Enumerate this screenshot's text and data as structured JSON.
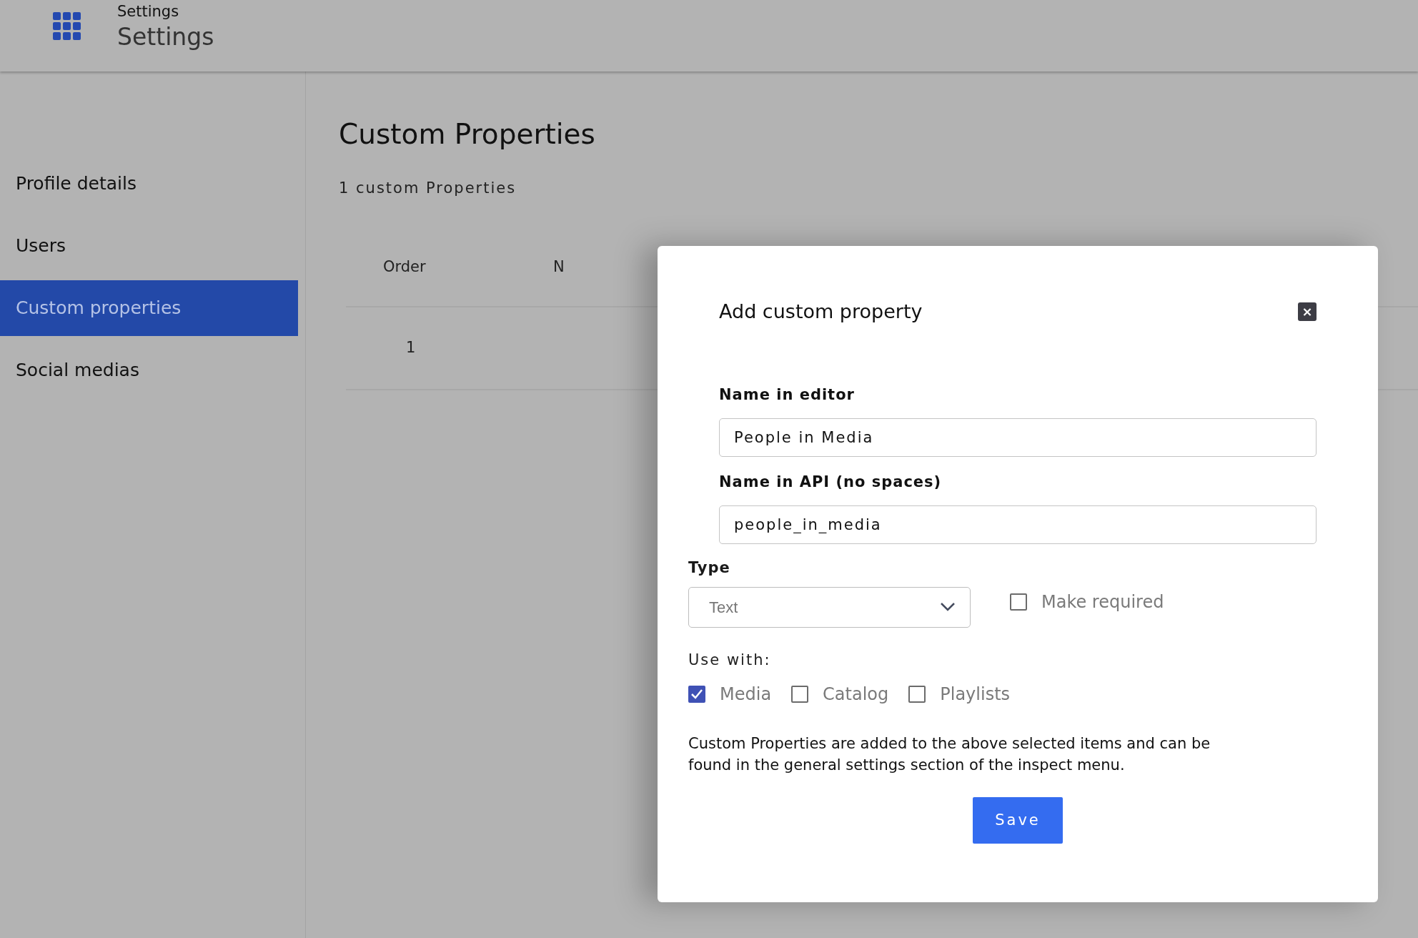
{
  "header": {
    "subtitle": "Settings",
    "title": "Settings"
  },
  "sidebar": {
    "items": [
      {
        "label": "Profile details",
        "selected": false
      },
      {
        "label": "Users",
        "selected": false
      },
      {
        "label": "Custom properties",
        "selected": true
      },
      {
        "label": "Social medias",
        "selected": false
      }
    ]
  },
  "main": {
    "heading": "Custom Properties",
    "count": "1 custom Properties",
    "table": {
      "columns": [
        "Order",
        "N"
      ],
      "rows": [
        [
          "1"
        ]
      ]
    }
  },
  "dialog": {
    "title": "Add custom property",
    "close": "×",
    "fields": [
      {
        "label": "Name in editor",
        "value": "People in Media"
      },
      {
        "label": "Name in API (no spaces)",
        "value": "people_in_media"
      }
    ],
    "type": {
      "label": "Type",
      "value": "Text"
    },
    "make_required": {
      "label": "Make required",
      "checked": false
    },
    "use_with": {
      "label": "Use with:",
      "options": [
        {
          "label": "Media",
          "checked": true
        },
        {
          "label": "Catalog",
          "checked": false
        },
        {
          "label": "Playlists",
          "checked": false
        }
      ]
    },
    "note": "Custom Properties are added to the above selected items and can be found in the general settings section of the inspect menu.",
    "save": "Save"
  }
}
